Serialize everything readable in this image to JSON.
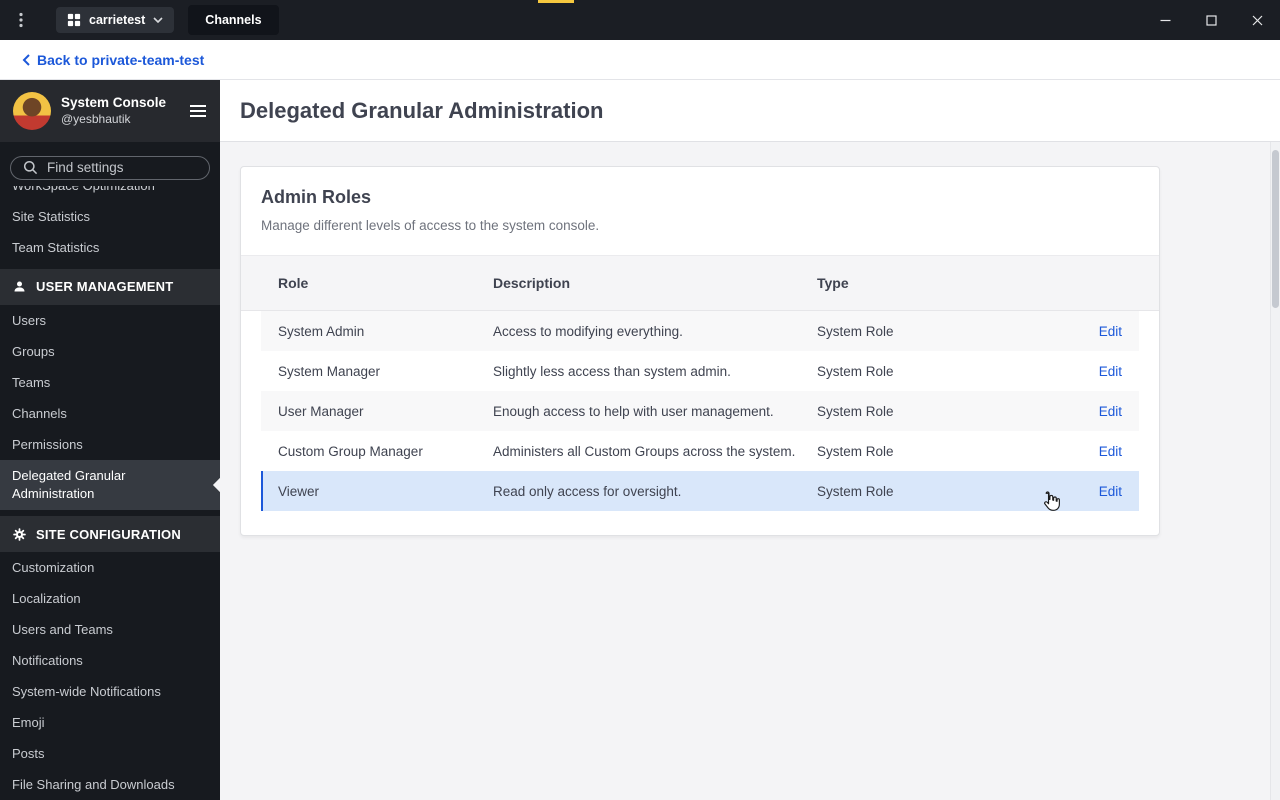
{
  "titlebar": {
    "team_label": "carrietest",
    "tab_label": "Channels"
  },
  "back_link": "Back to private-team-test",
  "sidebar": {
    "title": "System Console",
    "subtitle": "@yesbhautik",
    "search_placeholder": "Find settings",
    "active_item": "Delegated Granular Administration",
    "sections": [
      {
        "header": null,
        "icon": null,
        "items": [
          "WorkSpace Optimization",
          "Site Statistics",
          "Team Statistics"
        ]
      },
      {
        "header": "USER MANAGEMENT",
        "icon": "user-icon",
        "items": [
          "Users",
          "Groups",
          "Teams",
          "Channels",
          "Permissions",
          "Delegated Granular Administration"
        ]
      },
      {
        "header": "SITE CONFIGURATION",
        "icon": "gear-icon",
        "items": [
          "Customization",
          "Localization",
          "Users and Teams",
          "Notifications",
          "System-wide Notifications",
          "Emoji",
          "Posts",
          "File Sharing and Downloads"
        ]
      }
    ]
  },
  "main": {
    "title": "Delegated Granular Administration",
    "card": {
      "title": "Admin Roles",
      "subtitle": "Manage different levels of access to the system console.",
      "table": {
        "columns": [
          "Role",
          "Description",
          "Type",
          ""
        ],
        "rows": [
          {
            "role": "System Admin",
            "description": "Access to modifying everything.",
            "type": "System Role",
            "action": "Edit",
            "highlighted": false
          },
          {
            "role": "System Manager",
            "description": "Slightly less access than system admin.",
            "type": "System Role",
            "action": "Edit",
            "highlighted": false
          },
          {
            "role": "User Manager",
            "description": "Enough access to help with user management.",
            "type": "System Role",
            "action": "Edit",
            "highlighted": false
          },
          {
            "role": "Custom Group Manager",
            "description": "Administers all Custom Groups across the system.",
            "type": "System Role",
            "action": "Edit",
            "highlighted": false
          },
          {
            "role": "Viewer",
            "description": "Read only access for oversight.",
            "type": "System Role",
            "action": "Edit",
            "highlighted": true
          }
        ]
      }
    }
  },
  "colors": {
    "accent_blue": "#1c58d9",
    "highlight_row": "#d9e7fa",
    "titlebar_bg": "#1b1e24",
    "sidebar_bg": "#171a1f",
    "page_bg": "#f4f4f6"
  }
}
